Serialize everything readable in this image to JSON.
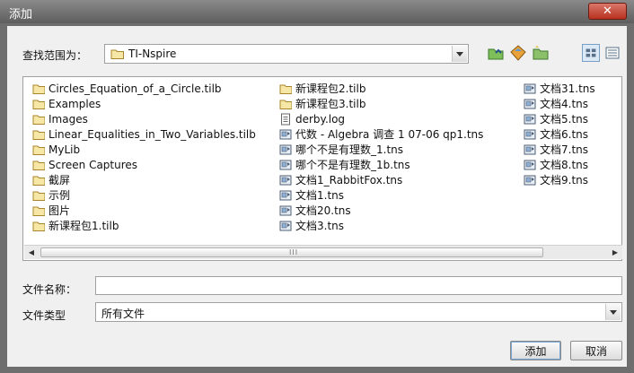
{
  "window": {
    "title": "添加",
    "close_label": "✕"
  },
  "lookin": {
    "label": "查找范围为：",
    "value": "TI-Nspire"
  },
  "toolbar": {
    "icons": [
      "up-folder-icon",
      "home-icon",
      "new-folder-icon",
      "list-view-icon",
      "details-view-icon"
    ]
  },
  "files": {
    "col1": [
      {
        "name": "Circles_Equation_of_a_Circle.tilb",
        "type": "folder"
      },
      {
        "name": "Examples",
        "type": "folder"
      },
      {
        "name": "Images",
        "type": "folder"
      },
      {
        "name": "Linear_Equalities_in_Two_Variables.tilb",
        "type": "folder"
      },
      {
        "name": "MyLib",
        "type": "folder"
      },
      {
        "name": "Screen Captures",
        "type": "folder"
      },
      {
        "name": "截屏",
        "type": "folder"
      },
      {
        "name": "示例",
        "type": "folder"
      },
      {
        "name": "图片",
        "type": "folder"
      },
      {
        "name": "新课程包1.tilb",
        "type": "folder"
      }
    ],
    "col2": [
      {
        "name": "新课程包2.tilb",
        "type": "folder"
      },
      {
        "name": "新课程包3.tilb",
        "type": "folder"
      },
      {
        "name": "derby.log",
        "type": "log"
      },
      {
        "name": "代数 - Algebra 调查 1 07-06 qp1.tns",
        "type": "tns"
      },
      {
        "name": "哪个不是有理数_1.tns",
        "type": "tns"
      },
      {
        "name": "哪个不是有理数_1b.tns",
        "type": "tns"
      },
      {
        "name": "文档1_RabbitFox.tns",
        "type": "tns"
      },
      {
        "name": "文档1.tns",
        "type": "tns"
      },
      {
        "name": "文档20.tns",
        "type": "tns"
      },
      {
        "name": "文档3.tns",
        "type": "tns"
      }
    ],
    "col3": [
      {
        "name": "文档31.tns",
        "type": "tns"
      },
      {
        "name": "文档4.tns",
        "type": "tns"
      },
      {
        "name": "文档5.tns",
        "type": "tns"
      },
      {
        "name": "文档6.tns",
        "type": "tns"
      },
      {
        "name": "文档7.tns",
        "type": "tns"
      },
      {
        "name": "文档8.tns",
        "type": "tns"
      },
      {
        "name": "文档9.tns",
        "type": "tns"
      }
    ]
  },
  "scrollbar": {
    "grip": "III"
  },
  "filename": {
    "label": "文件名称：",
    "value": ""
  },
  "filetype": {
    "label": "文件类型",
    "value": "所有文件"
  },
  "buttons": {
    "add": "添加",
    "cancel": "取消"
  }
}
